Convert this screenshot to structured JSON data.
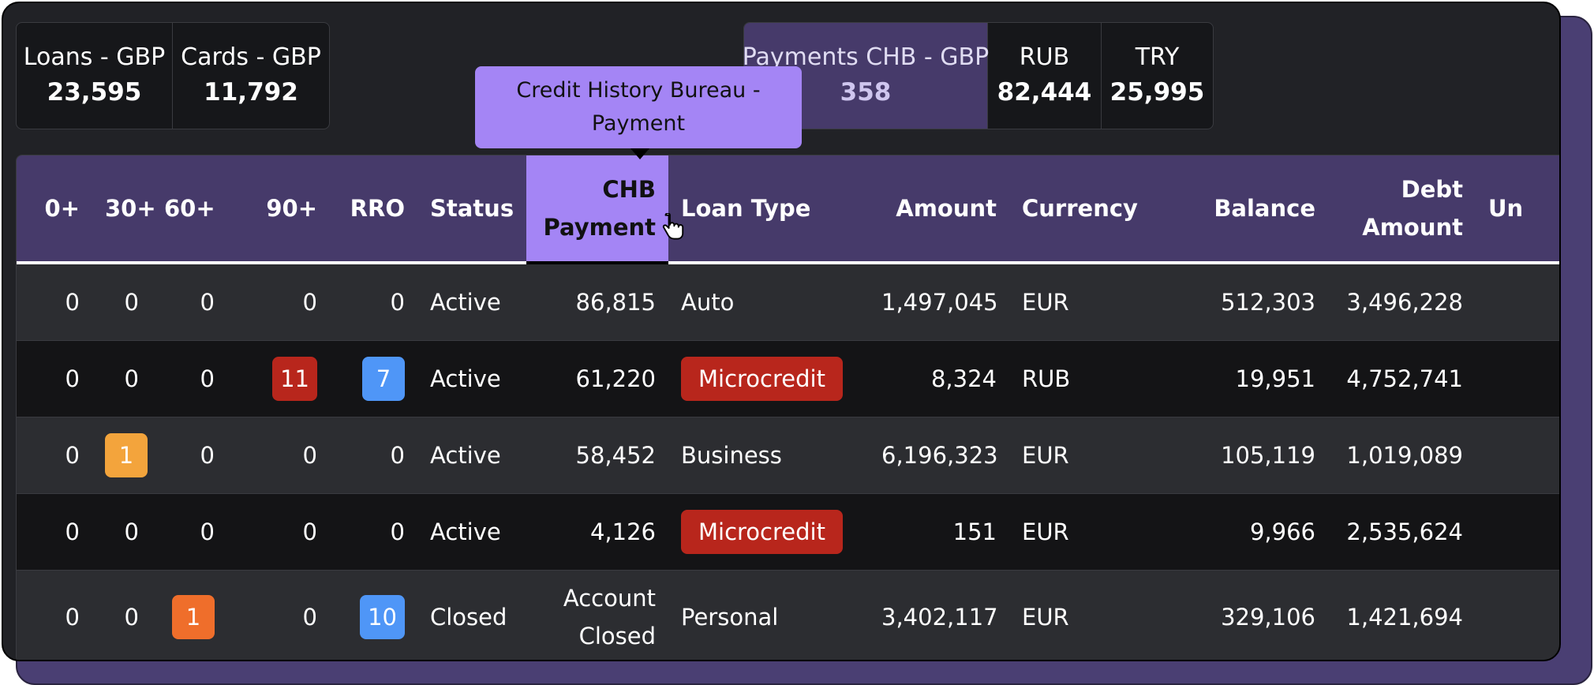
{
  "stats_left": [
    {
      "label": "Loans - GBP",
      "value": "23,595"
    },
    {
      "label": "Cards - GBP",
      "value": "11,792"
    }
  ],
  "stats_right": [
    {
      "label": "Payments CHB - GBP",
      "value": "358"
    },
    {
      "label": "RUB",
      "value": "82,444"
    },
    {
      "label": "TRY",
      "value": "25,995"
    }
  ],
  "tooltip": {
    "text": "Credit History Bureau - Payment"
  },
  "table": {
    "headers": {
      "c0": "0+",
      "c30": "30+",
      "c60": "60+",
      "c90": "90+",
      "rro": "RRO",
      "status": "Status",
      "chb": "CHB Payment",
      "loan_type": "Loan Type",
      "amount": "Amount",
      "currency": "Currency",
      "balance": "Balance",
      "debt": "Debt Amount",
      "cut": "Un"
    },
    "rows": [
      {
        "c0": "0",
        "c30": "0",
        "c60": "0",
        "c90": "0",
        "rro": "0",
        "status": "Active",
        "chb": "86,815",
        "loan_type": "Auto",
        "amount": "1,497,045",
        "currency": "EUR",
        "balance": "512,303",
        "debt": "3,496,228"
      },
      {
        "c0": "0",
        "c30": "0",
        "c60": "0",
        "c90": "11",
        "rro": "7",
        "status": "Active",
        "chb": "61,220",
        "loan_type": "Microcredit",
        "amount": "8,324",
        "currency": "RUB",
        "balance": "19,951",
        "debt": "4,752,741"
      },
      {
        "c0": "0",
        "c30": "1",
        "c60": "0",
        "c90": "0",
        "rro": "0",
        "status": "Active",
        "chb": "58,452",
        "loan_type": "Business",
        "amount": "6,196,323",
        "currency": "EUR",
        "balance": "105,119",
        "debt": "1,019,089"
      },
      {
        "c0": "0",
        "c30": "0",
        "c60": "0",
        "c90": "0",
        "rro": "0",
        "status": "Active",
        "chb": "4,126",
        "loan_type": "Microcredit",
        "amount": "151",
        "currency": "EUR",
        "balance": "9,966",
        "debt": "2,535,624"
      },
      {
        "c0": "0",
        "c30": "0",
        "c60": "1",
        "c90": "0",
        "rro": "10",
        "status": "Closed",
        "chb": "Account Closed",
        "loan_type": "Personal",
        "amount": "3,402,117",
        "currency": "EUR",
        "balance": "329,106",
        "debt": "1,421,694"
      }
    ]
  },
  "colors": {
    "header_bg": "#463a6a",
    "active_column": "#a485f5",
    "badge_red": "#b8261c",
    "badge_blue": "#4f96f7",
    "badge_amber": "#f3a43c",
    "badge_orange": "#ef6e2b"
  }
}
